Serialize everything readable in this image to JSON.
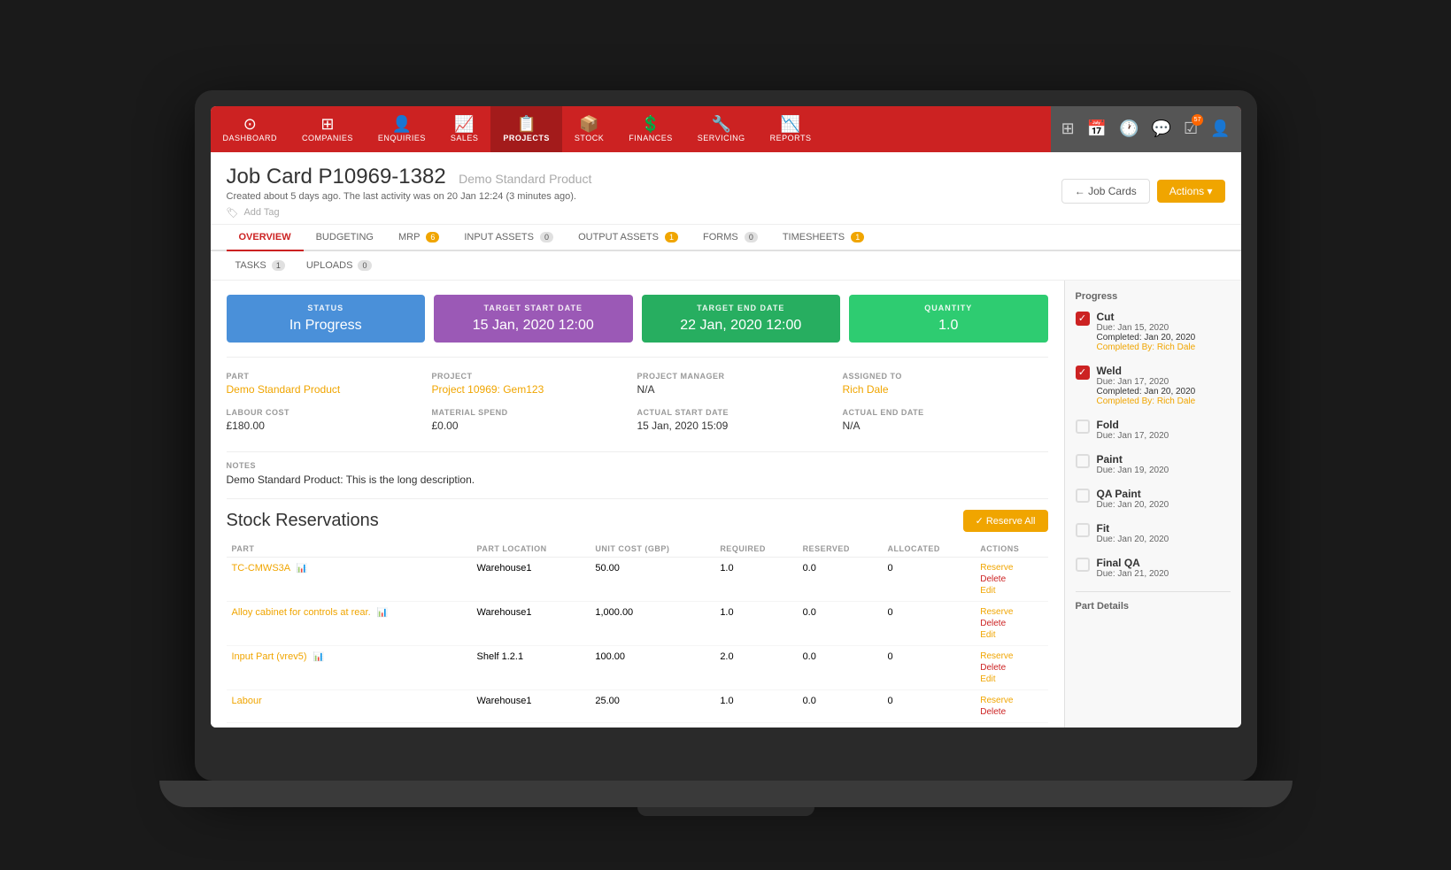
{
  "nav": {
    "items": [
      {
        "id": "dashboard",
        "label": "DASHBOARD",
        "icon": "⊙"
      },
      {
        "id": "companies",
        "label": "COMPANIES",
        "icon": "⊞"
      },
      {
        "id": "enquiries",
        "label": "ENQUIRIES",
        "icon": "👤"
      },
      {
        "id": "sales",
        "label": "SALES",
        "icon": "📈"
      },
      {
        "id": "projects",
        "label": "PROJECTS",
        "icon": "📋",
        "active": true
      },
      {
        "id": "stock",
        "label": "STOCK",
        "icon": "📦"
      },
      {
        "id": "finances",
        "label": "FINANCES",
        "icon": "💲"
      },
      {
        "id": "servicing",
        "label": "SERVICING",
        "icon": "🔧"
      },
      {
        "id": "reports",
        "label": "REPORTS",
        "icon": "📉"
      }
    ],
    "right_icons": [
      {
        "id": "grid",
        "icon": "⊞"
      },
      {
        "id": "calendar",
        "icon": "📅"
      },
      {
        "id": "clock",
        "icon": "🕐"
      },
      {
        "id": "chat",
        "icon": "💬"
      },
      {
        "id": "tasks",
        "icon": "☑",
        "badge": "57"
      },
      {
        "id": "user",
        "icon": "👤"
      }
    ]
  },
  "header": {
    "job_card_number": "Job Card P10969-1382",
    "job_card_subtitle": "Demo Standard Product",
    "meta_line": "Created about 5 days ago. The last activity was on 20 Jan 12:24 (3 minutes ago).",
    "add_tag": "Add Tag",
    "btn_job_cards": "← Job Cards",
    "btn_actions": "Actions ▾"
  },
  "tabs": [
    {
      "id": "overview",
      "label": "OVERVIEW",
      "active": true
    },
    {
      "id": "budgeting",
      "label": "BUDGETING"
    },
    {
      "id": "mrp",
      "label": "MRP",
      "badge": "6"
    },
    {
      "id": "input_assets",
      "label": "INPUT ASSETS",
      "badge": "0"
    },
    {
      "id": "output_assets",
      "label": "OUTPUT ASSETS",
      "badge": "1"
    },
    {
      "id": "forms",
      "label": "FORMS",
      "badge": "0"
    },
    {
      "id": "timesheets",
      "label": "TIMESHEETS",
      "badge": "1"
    }
  ],
  "sub_tabs": [
    {
      "id": "tasks",
      "label": "TASKS",
      "badge": "1"
    },
    {
      "id": "uploads",
      "label": "UPLOADS",
      "badge": "0"
    }
  ],
  "status_cards": {
    "status": {
      "label": "STATUS",
      "value": "In Progress",
      "color": "#4a90d9"
    },
    "target_start": {
      "label": "TARGET START DATE",
      "value": "15 Jan, 2020 12:00",
      "color": "#9b59b6"
    },
    "target_end": {
      "label": "TARGET END DATE",
      "value": "22 Jan, 2020 12:00",
      "color": "#27ae60"
    },
    "quantity": {
      "label": "QUANTITY",
      "value": "1.0",
      "color": "#2ecc71"
    }
  },
  "info": {
    "part_label": "PART",
    "part_value": "Demo Standard Product",
    "project_label": "PROJECT",
    "project_value": "Project 10969: Gem123",
    "project_manager_label": "PROJECT MANAGER",
    "project_manager_value": "N/A",
    "assigned_to_label": "ASSIGNED TO",
    "assigned_to_value": "Rich Dale",
    "labour_cost_label": "LABOUR COST",
    "labour_cost_value": "£180.00",
    "material_spend_label": "MATERIAL SPEND",
    "material_spend_value": "£0.00",
    "actual_start_label": "ACTUAL START DATE",
    "actual_start_value": "15 Jan, 2020 15:09",
    "actual_end_label": "ACTUAL END DATE",
    "actual_end_value": "N/A"
  },
  "notes": {
    "label": "NOTES",
    "value": "Demo Standard Product: This is the long description."
  },
  "stock": {
    "title": "Stock Reservations",
    "btn_reserve_all": "✓ Reserve All",
    "columns": [
      "PART",
      "PART LOCATION",
      "UNIT COST (GBP)",
      "REQUIRED",
      "RESERVED",
      "ALLOCATED",
      "ACTIONS"
    ],
    "rows": [
      {
        "part": "TC-CMWS3A",
        "location": "Warehouse1",
        "unit_cost": "50.00",
        "required": "1.0",
        "reserved": "0.0",
        "allocated": "0",
        "actions": [
          "Reserve",
          "Delete",
          "Edit"
        ]
      },
      {
        "part": "Alloy cabinet for controls at rear.",
        "location": "Warehouse1",
        "unit_cost": "1,000.00",
        "required": "1.0",
        "reserved": "0.0",
        "allocated": "0",
        "actions": [
          "Reserve",
          "Delete",
          "Edit"
        ]
      },
      {
        "part": "Input Part (vrev5)",
        "location": "Shelf 1.2.1",
        "unit_cost": "100.00",
        "required": "2.0",
        "reserved": "0.0",
        "allocated": "0",
        "actions": [
          "Reserve",
          "Delete",
          "Edit"
        ]
      },
      {
        "part": "Labour",
        "location": "Warehouse1",
        "unit_cost": "25.00",
        "required": "1.0",
        "reserved": "0.0",
        "allocated": "0",
        "actions": [
          "Reserve",
          "Delete"
        ]
      }
    ]
  },
  "progress": {
    "title": "Progress",
    "items": [
      {
        "name": "Cut",
        "checked": true,
        "due": "Due: Jan 15, 2020",
        "completed": "Completed: Jan 20, 2020",
        "by": "Completed By: Rich Dale"
      },
      {
        "name": "Weld",
        "checked": true,
        "due": "Due: Jan 17, 2020",
        "completed": "Completed: Jan 20, 2020",
        "by": "Completed By: Rich Dale"
      },
      {
        "name": "Fold",
        "checked": false,
        "due": "Due: Jan 17, 2020",
        "completed": "",
        "by": ""
      },
      {
        "name": "Paint",
        "checked": false,
        "due": "Due: Jan 19, 2020",
        "completed": "",
        "by": ""
      },
      {
        "name": "QA Paint",
        "checked": false,
        "due": "Due: Jan 20, 2020",
        "completed": "",
        "by": ""
      },
      {
        "name": "Fit",
        "checked": false,
        "due": "Due: Jan 20, 2020",
        "completed": "",
        "by": ""
      },
      {
        "name": "Final QA",
        "checked": false,
        "due": "Due: Jan 21, 2020",
        "completed": "",
        "by": ""
      }
    ]
  },
  "part_details": {
    "title": "Part Details"
  }
}
